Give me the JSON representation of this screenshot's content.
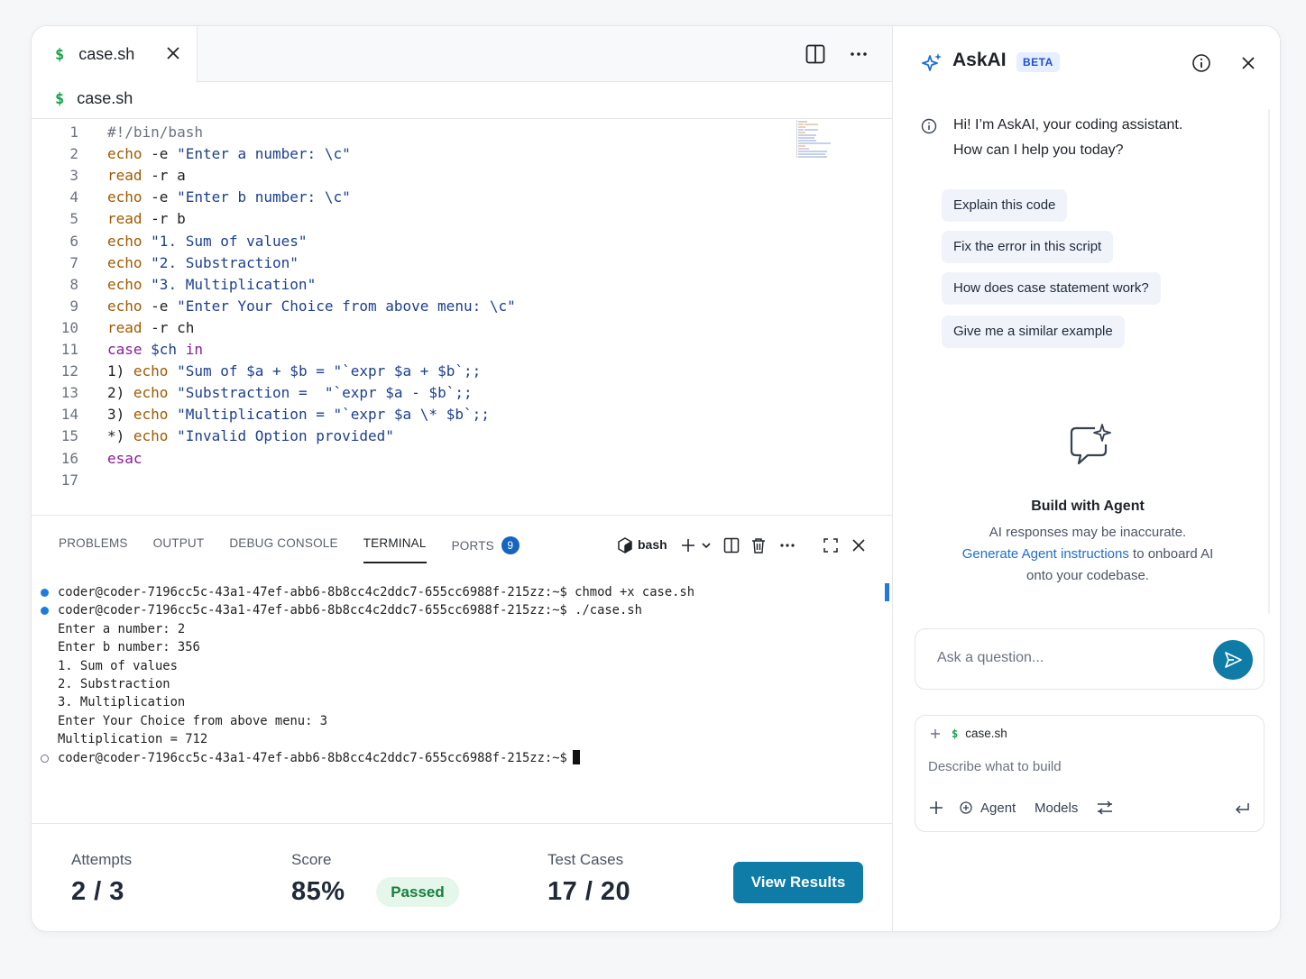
{
  "editor": {
    "tab_label": "case.sh",
    "breadcrumb": "case.sh",
    "dollar": "$",
    "code_lines": [
      {
        "n": "1",
        "parts": [
          [
            "cm",
            "#!/bin/bash"
          ]
        ]
      },
      {
        "n": "2",
        "parts": [
          [
            "kw",
            "echo"
          ],
          [
            "",
            " -e "
          ],
          [
            "str",
            "\"Enter a number: \\c\""
          ]
        ]
      },
      {
        "n": "3",
        "parts": [
          [
            "kw",
            "read"
          ],
          [
            "",
            " -r a"
          ]
        ]
      },
      {
        "n": "4",
        "parts": [
          [
            "kw",
            "echo"
          ],
          [
            "",
            " -e "
          ],
          [
            "str",
            "\"Enter b number: \\c\""
          ]
        ]
      },
      {
        "n": "5",
        "parts": [
          [
            "kw",
            "read"
          ],
          [
            "",
            " -r b"
          ]
        ]
      },
      {
        "n": "6",
        "parts": [
          [
            "kw",
            "echo"
          ],
          [
            "",
            " "
          ],
          [
            "str",
            "\"1. Sum of values\""
          ]
        ]
      },
      {
        "n": "7",
        "parts": [
          [
            "kw",
            "echo"
          ],
          [
            "",
            " "
          ],
          [
            "str",
            "\"2. Substraction\""
          ]
        ]
      },
      {
        "n": "8",
        "parts": [
          [
            "kw",
            "echo"
          ],
          [
            "",
            " "
          ],
          [
            "str",
            "\"3. Multiplication\""
          ]
        ]
      },
      {
        "n": "9",
        "parts": [
          [
            "kw",
            "echo"
          ],
          [
            "",
            " -e "
          ],
          [
            "str",
            "\"Enter Your Choice from above menu: \\c\""
          ]
        ]
      },
      {
        "n": "10",
        "parts": [
          [
            "kw",
            "read"
          ],
          [
            "",
            " -r ch"
          ]
        ]
      },
      {
        "n": "11",
        "parts": [
          [
            "kp",
            "case"
          ],
          [
            "str",
            " $ch "
          ],
          [
            "kp",
            "in"
          ]
        ]
      },
      {
        "n": "12",
        "parts": [
          [
            "",
            "1) "
          ],
          [
            "kw",
            "echo"
          ],
          [
            "",
            " "
          ],
          [
            "str",
            "\"Sum of $a + $b = \"`expr $a + $b`;;"
          ]
        ]
      },
      {
        "n": "13",
        "parts": [
          [
            "",
            "2) "
          ],
          [
            "kw",
            "echo"
          ],
          [
            "",
            " "
          ],
          [
            "str",
            "\"Substraction =  \"`expr $a - $b`;;"
          ]
        ]
      },
      {
        "n": "14",
        "parts": [
          [
            "",
            "3) "
          ],
          [
            "kw",
            "echo"
          ],
          [
            "",
            " "
          ],
          [
            "str",
            "\"Multiplication = \"`expr $a \\* $b`;;"
          ]
        ]
      },
      {
        "n": "15",
        "parts": [
          [
            "",
            "*) "
          ],
          [
            "kw",
            "echo"
          ],
          [
            "",
            " "
          ],
          [
            "str",
            "\"Invalid Option provided\""
          ]
        ]
      },
      {
        "n": "16",
        "parts": [
          [
            "kp",
            "esac"
          ]
        ]
      },
      {
        "n": "17",
        "parts": []
      }
    ]
  },
  "panel": {
    "tabs": [
      "PROBLEMS",
      "OUTPUT",
      "DEBUG CONSOLE",
      "TERMINAL",
      "PORTS"
    ],
    "active_tab": "TERMINAL",
    "ports_count": "9",
    "shell_label": "bash",
    "terminal_lines": [
      {
        "dot": "fill",
        "text": "coder@coder-7196cc5c-43a1-47ef-abb6-8b8cc4c2ddc7-655cc6988f-215zz:~$ chmod +x case.sh"
      },
      {
        "dot": "fill",
        "text": "coder@coder-7196cc5c-43a1-47ef-abb6-8b8cc4c2ddc7-655cc6988f-215zz:~$ ./case.sh"
      },
      {
        "dot": "",
        "text": "Enter a number: 2"
      },
      {
        "dot": "",
        "text": "Enter b number: 356"
      },
      {
        "dot": "",
        "text": "1. Sum of values"
      },
      {
        "dot": "",
        "text": "2. Substraction"
      },
      {
        "dot": "",
        "text": "3. Multiplication"
      },
      {
        "dot": "",
        "text": "Enter Your Choice from above menu: 3"
      },
      {
        "dot": "",
        "text": "Multiplication = 712"
      },
      {
        "dot": "hollow",
        "text": "coder@coder-7196cc5c-43a1-47ef-abb6-8b8cc4c2ddc7-655cc6988f-215zz:~$",
        "cursor": true
      }
    ]
  },
  "stats": {
    "attempts_label": "Attempts",
    "attempts_value": "2 / 3",
    "score_label": "Score",
    "score_value": "85%",
    "status_badge": "Passed",
    "tests_label": "Test Cases",
    "tests_value": "17 / 20",
    "view_results": "View Results"
  },
  "askai": {
    "title": "AskAI",
    "badge": "BETA",
    "greeting_line1": "Hi! I’m AskAI, your coding assistant.",
    "greeting_line2": "How can I help you today?",
    "suggestions": [
      "Explain this code",
      "Fix the error in this script",
      "How does case statement work?",
      "Give me a similar example"
    ],
    "agent_title": "Build with Agent",
    "agent_disclaimer": "AI responses may be inaccurate.",
    "agent_link": "Generate Agent instructions",
    "agent_link_suffix": " to onboard AI",
    "agent_line3": "onto your codebase.",
    "ask_placeholder": "Ask a question...",
    "build_file": "case.sh",
    "build_placeholder": "Describe what to build",
    "agent_label": "Agent",
    "models_label": "Models"
  },
  "colors": {
    "accent": "#0e7ca6",
    "keyword": "#a05a00",
    "control_keyword": "#8b1a9c",
    "string": "#1c3f8f",
    "passed": "#15803d"
  }
}
